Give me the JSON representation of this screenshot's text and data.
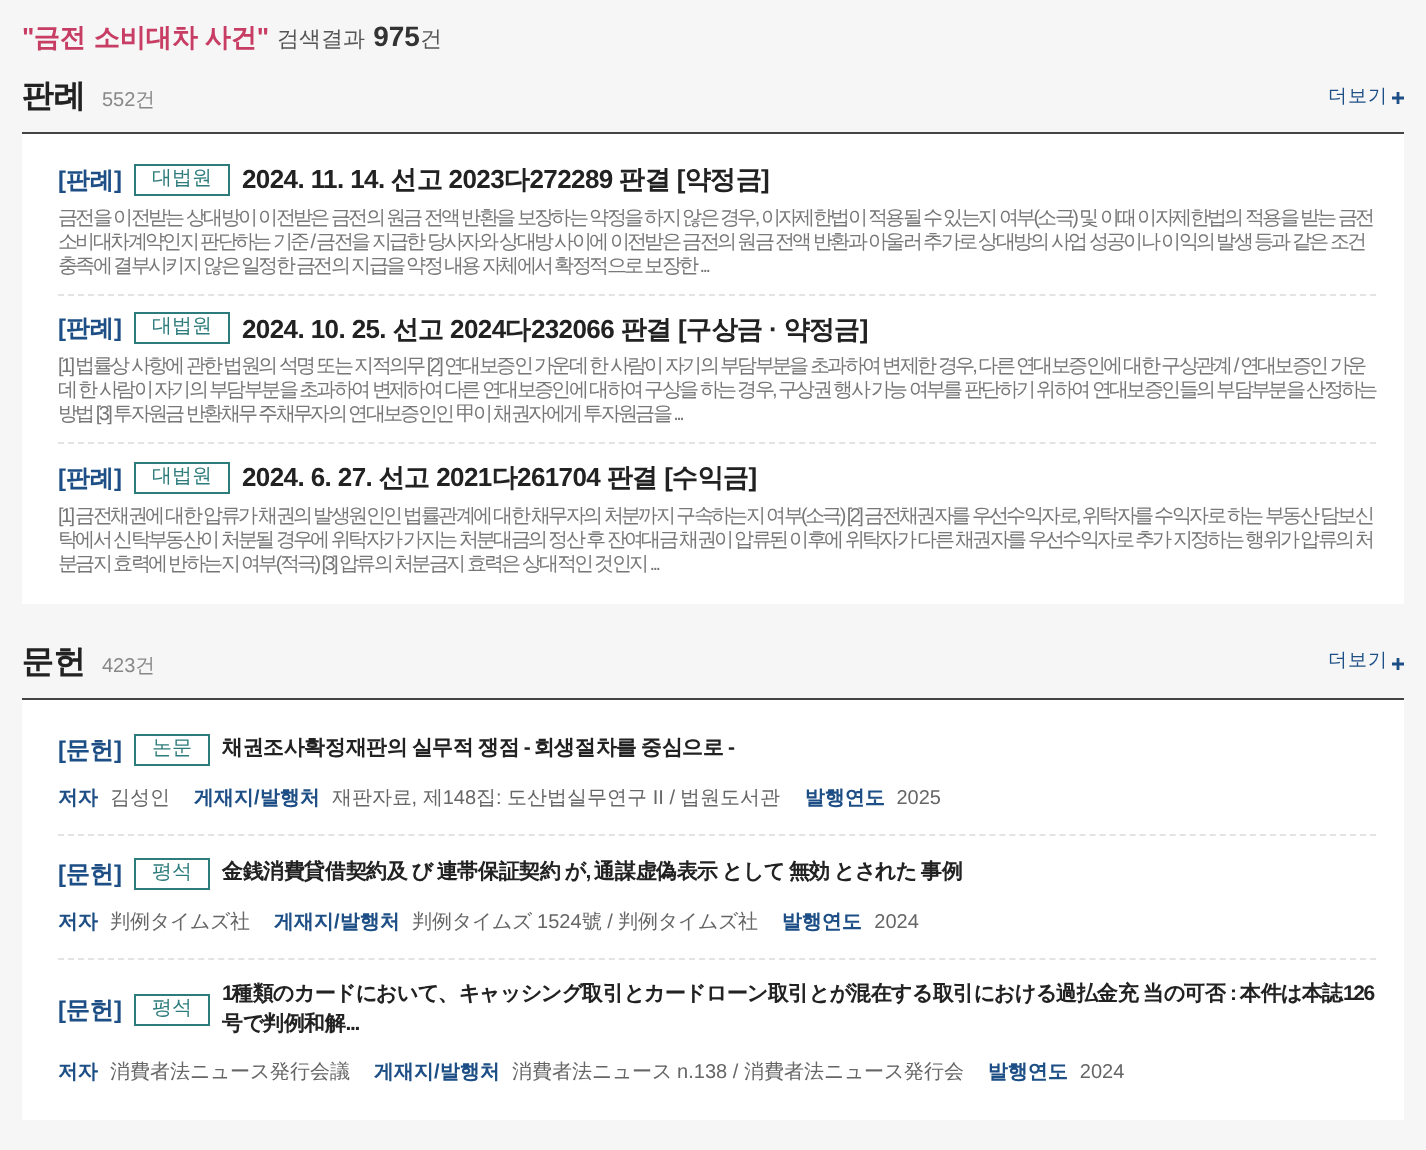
{
  "header": {
    "query": "\"금전 소비대차 사건\"",
    "label": "검색결과",
    "count": "975",
    "unit": "건"
  },
  "sections": [
    {
      "title": "판례",
      "count": "552건",
      "more": "더보기",
      "items": [
        {
          "kind": "case",
          "tag": "[판례]",
          "badge": "대법원",
          "title": "2024. 11. 14. 선고 2023다272289 판결 [약정금]",
          "snippet": "금전을 이전받는 상대방이 이전받은 금전의 원금 전액 반환을 보장하는 약정을 하지 않은 경우, 이자제한법이 적용될 수 있는지 여부(소극) 및 이때 이자제한법의 적용을 받는 금전소비대차계약인지 판단하는 기준 / 금전을 지급한 당사자와 상대방 사이에 이전받은 금전의 원금 전액 반환과 아울러 추가로 상대방의 사업 성공이나 이익의 발생 등과 같은 조건충족에 결부시키지 않은 일정한 금전의 지급을 약정 내용 자체에서 확정적으로 보장한 ..."
        },
        {
          "kind": "case",
          "tag": "[판례]",
          "badge": "대법원",
          "title": "2024. 10. 25. 선고 2024다232066 판결 [구상금 · 약정금]",
          "snippet": "[1] 법률상 사항에 관한 법원의 석명 또는 지적의무 [2] 연대보증인 가운데 한 사람이 자기의 부담부분을 초과하여 변제한 경우, 다른 연대보증인에 대한 구상관계 / 연대보증인 가운데 한 사람이 자기의 부담부분을 초과하여 변제하여 다른 연대보증인에 대하여 구상을 하는 경우, 구상권 행사 가능 여부를 판단하기 위하여 연대보증인들의 부담부분을 산정하는 방법 [3] 투자원금 반환채무 주채무자의 연대보증인인 甲이 채권자에게 투자원금을 ..."
        },
        {
          "kind": "case",
          "tag": "[판례]",
          "badge": "대법원",
          "title": "2024. 6. 27. 선고 2021다261704 판결 [수익금]",
          "snippet": "[1] 금전채권에 대한 압류가 채권의 발생원인인 법률관계에 대한 채무자의 처분까지 구속하는지 여부(소극) [2] 금전채권자를 우선수익자로, 위탁자를 수익자로 하는 부동산 담보신탁에서 신탁부동산이 처분될 경우에 위탁자가 가지는 처분대금의 정산 후 잔여대금 채권이 압류된 이후에 위탁자가 다른 채권자를 우선수익자로 추가 지정하는 행위가 압류의 처분금지 효력에 반하는지 여부(적극) [3] 압류의 처분금지 효력은 상대적인 것인지 ..."
        }
      ]
    },
    {
      "title": "문헌",
      "count": "423건",
      "more": "더보기",
      "items": [
        {
          "kind": "literature",
          "tag": "[문헌]",
          "badge": "논문",
          "title": "채권조사확정재판의 실무적 쟁점 - 회생절차를 중심으로 -",
          "meta": [
            {
              "label": "저자",
              "value": "김성인"
            },
            {
              "label": "게재지/발행처",
              "value": "재판자료, 제148집: 도산법실무연구 II / 법원도서관"
            },
            {
              "label": "발행연도",
              "value": "2025"
            }
          ]
        },
        {
          "kind": "literature",
          "tag": "[문헌]",
          "badge": "평석",
          "title": "金銭消費貸借契約及 び 連帯保証契約 が, 通謀虚偽表示 として 無効 とされた 事例",
          "meta": [
            {
              "label": "저자",
              "value": "判例タイムズ社"
            },
            {
              "label": "게재지/발행처",
              "value": "判例タイムズ 1524號 / 判例タイムズ社"
            },
            {
              "label": "발행연도",
              "value": "2024"
            }
          ]
        },
        {
          "kind": "literature",
          "tag": "[문헌]",
          "badge": "평석",
          "title": "1種類のカードにおいて、キャッシング取引とカードローン取引とが混在する取引における過払金充 当の可否 : 本件は本誌126号で判例和解...",
          "meta": [
            {
              "label": "저자",
              "value": "消費者法ニュース発行会議"
            },
            {
              "label": "게재지/발행처",
              "value": "消費者法ニュース n.138 / 消費者法ニュース発行会"
            },
            {
              "label": "발행연도",
              "value": "2024"
            }
          ]
        }
      ]
    }
  ]
}
